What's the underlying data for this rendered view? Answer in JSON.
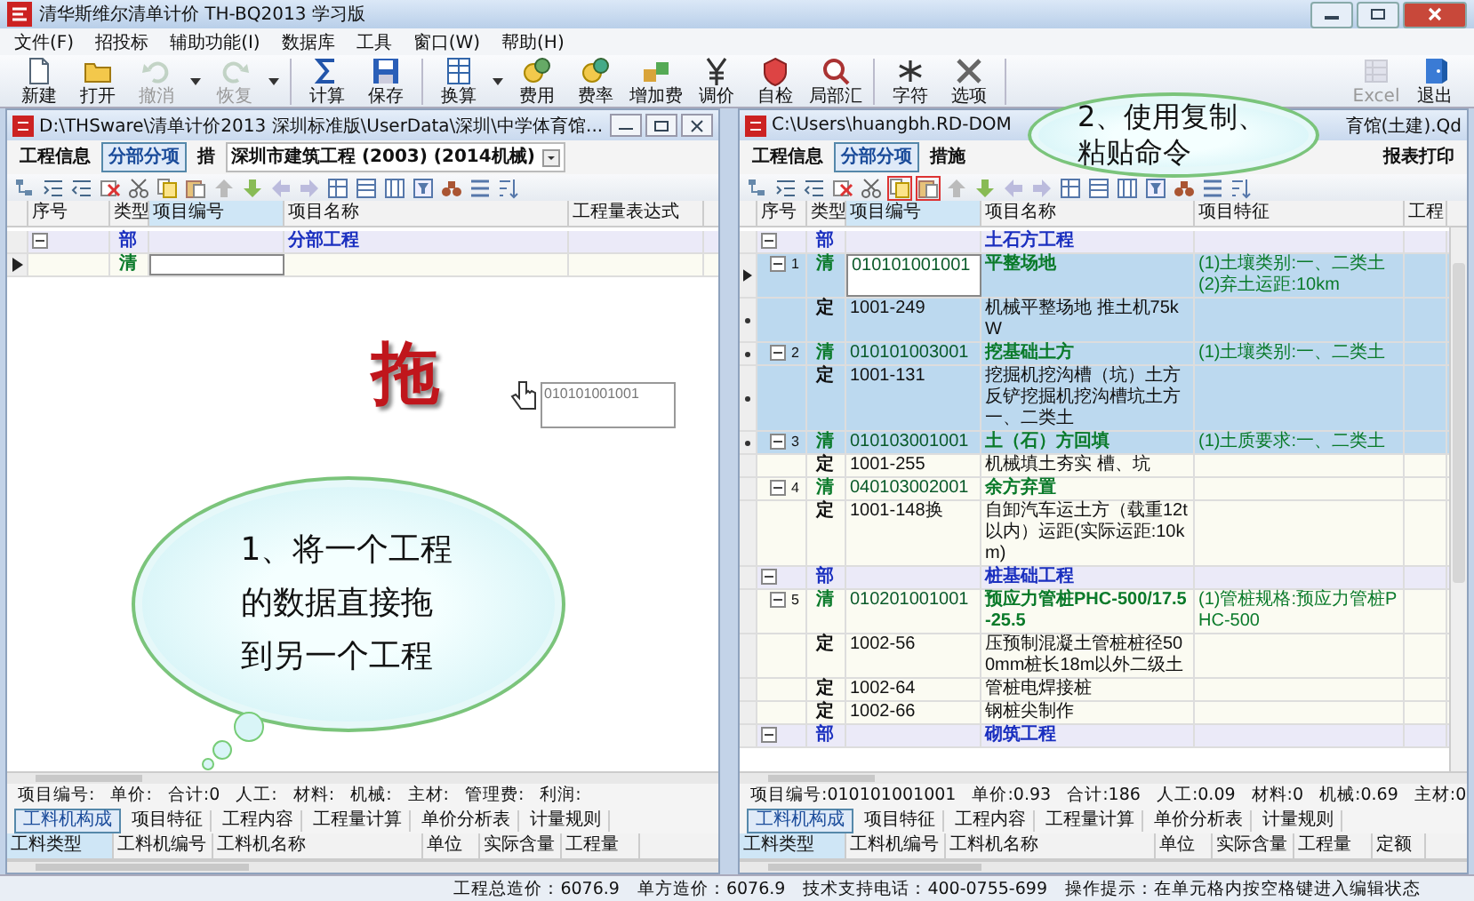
{
  "window": {
    "title": "清华斯维尔清单计价 TH-BQ2013 学习版"
  },
  "menu": [
    "文件(F)",
    "招投标",
    "辅助功能(I)",
    "数据库",
    "工具",
    "窗口(W)",
    "帮助(H)"
  ],
  "toolbar": [
    {
      "label": "新建",
      "kind": "new",
      "disabled": false,
      "dropdown": false
    },
    {
      "label": "打开",
      "kind": "open",
      "disabled": false,
      "dropdown": false
    },
    {
      "label": "撤消",
      "kind": "undo",
      "disabled": true,
      "dropdown": true
    },
    {
      "label": "恢复",
      "kind": "redo",
      "disabled": true,
      "dropdown": true
    },
    {
      "label": "计算",
      "kind": "calc",
      "disabled": false,
      "dropdown": false
    },
    {
      "label": "保存",
      "kind": "save",
      "disabled": false,
      "dropdown": false
    },
    {
      "label": "换算",
      "kind": "convert",
      "disabled": false,
      "dropdown": true
    },
    {
      "label": "费用",
      "kind": "fee",
      "disabled": false,
      "dropdown": false
    },
    {
      "label": "费率",
      "kind": "rate",
      "disabled": false,
      "dropdown": false
    },
    {
      "label": "增加费",
      "kind": "addfee",
      "disabled": false,
      "dropdown": false
    },
    {
      "label": "调价",
      "kind": "adjust",
      "disabled": false,
      "dropdown": false
    },
    {
      "label": "自检",
      "kind": "check",
      "disabled": false,
      "dropdown": false
    },
    {
      "label": "局部汇",
      "kind": "summary",
      "disabled": false,
      "dropdown": false
    },
    {
      "label": "字符",
      "kind": "char",
      "disabled": false,
      "dropdown": false
    },
    {
      "label": "选项",
      "kind": "options",
      "disabled": false,
      "dropdown": false
    },
    {
      "label": "Excel",
      "kind": "excel",
      "disabled": true,
      "dropdown": false
    },
    {
      "label": "退出",
      "kind": "exit",
      "disabled": false,
      "dropdown": false
    }
  ],
  "callouts": [
    {
      "text": "1、将一个工程的数据直接拖到另一个工程"
    },
    {
      "text": "2、使用复制、粘贴命令"
    }
  ],
  "drag_label": "拖",
  "drag_ghost": "010101001001",
  "panes": [
    {
      "title": "D:\\THSware\\清单计价2013 深圳标准版\\UserData\\深圳\\中学体育馆...",
      "tabs": [
        {
          "label": "工程信息",
          "selected": false
        },
        {
          "label": "分部分项",
          "selected": true
        },
        {
          "label": "措",
          "selected": false
        }
      ],
      "library": "深圳市建筑工程 (2003) (2014机械)",
      "columns": [
        "序号",
        "类型",
        "项目编号",
        "项目名称",
        "工程量表达式"
      ],
      "rows": [
        {
          "kind": "bu",
          "type": "部",
          "name": "分部工程",
          "selected": false,
          "expanded": true,
          "current": false
        },
        {
          "kind": "qing",
          "type": "清",
          "selected": false,
          "expanded": false,
          "current": true
        }
      ],
      "info": [
        "项目编号:",
        "单价:",
        "合计:0",
        "人工:",
        "材料:",
        "机械:",
        "主材:",
        "管理费:",
        "利润:"
      ],
      "bottom_tabs": [
        {
          "label": "工料机构成",
          "selected": true
        },
        {
          "label": "项目特征",
          "selected": false
        },
        {
          "label": "工程内容",
          "selected": false
        },
        {
          "label": "工程量计算",
          "selected": false
        },
        {
          "label": "单价分析表",
          "selected": false
        },
        {
          "label": "计量规则",
          "selected": false
        }
      ],
      "bottom_columns": [
        "工料类型",
        "工料机编号",
        "工料机名称",
        "单位",
        "实际含量",
        "工程量"
      ]
    },
    {
      "title": "C:\\Users\\huangbh.RD-DOM",
      "title_tail": "育馆(土建).Qd",
      "tabs": [
        {
          "label": "工程信息",
          "selected": false
        },
        {
          "label": "分部分项",
          "selected": true
        },
        {
          "label": "措施",
          "selected": false
        }
      ],
      "tabs_end": [
        {
          "label": "报表打印",
          "selected": false
        }
      ],
      "toolbar_highlight": true,
      "columns": [
        "序号",
        "类型",
        "项目编号",
        "项目名称",
        "项目特征",
        "工程"
      ],
      "rows": [
        {
          "kind": "bu",
          "type": "部",
          "name": "土石方工程",
          "selected": false,
          "expanded": true,
          "current": false
        },
        {
          "kind": "qing",
          "no": "1",
          "type": "清",
          "code": "010101001001",
          "name": "平整场地",
          "features": [
            "(1)土壤类别:一、二类土",
            "(2)弃土运距:10km"
          ],
          "selected": true,
          "expanded": true,
          "current": true
        },
        {
          "kind": "ding",
          "type": "定",
          "code": "1001-249",
          "name": "机械平整场地 推土机75kW",
          "selected": true,
          "expanded": false,
          "current": false
        },
        {
          "kind": "qing",
          "no": "2",
          "type": "清",
          "code": "010101003001",
          "name": "挖基础土方",
          "features": [
            "(1)土壤类别:一、二类土"
          ],
          "selected": true,
          "expanded": true,
          "current": false
        },
        {
          "kind": "ding",
          "type": "定",
          "code": "1001-131",
          "name": "挖掘机挖沟槽（坑）土方反铲挖掘机挖沟槽坑土方一、二类土",
          "selected": true,
          "expanded": false,
          "current": false
        },
        {
          "kind": "qing",
          "no": "3",
          "type": "清",
          "code": "010103001001",
          "name": "土（石）方回填",
          "features": [
            "(1)土质要求:一、二类土"
          ],
          "selected": true,
          "expanded": true,
          "current": false
        },
        {
          "kind": "ding",
          "type": "定",
          "code": "1001-255",
          "name": "机械填土夯实 槽、坑",
          "selected": false,
          "expanded": false,
          "current": false
        },
        {
          "kind": "qing",
          "no": "4",
          "type": "清",
          "code": "040103002001",
          "name": "余方弃置",
          "selected": false,
          "expanded": true,
          "current": false
        },
        {
          "kind": "ding",
          "type": "定",
          "code": "1001-148换",
          "name": "自卸汽车运土方（载重12t以内）运距(实际运距:10km)",
          "selected": false,
          "expanded": false,
          "current": false
        },
        {
          "kind": "bu",
          "type": "部",
          "name": "桩基础工程",
          "selected": false,
          "expanded": true,
          "current": false
        },
        {
          "kind": "qing",
          "no": "5",
          "type": "清",
          "code": "010201001001",
          "name": "预应力管桩PHC-500/17.5-25.5",
          "features": [
            "(1)管桩规格:预应力管桩PHC-500"
          ],
          "selected": false,
          "expanded": true,
          "current": false
        },
        {
          "kind": "ding",
          "type": "定",
          "code": "1002-56",
          "name": "压预制混凝土管桩桩径500mm桩长18m以外二级土",
          "selected": false,
          "expanded": false,
          "current": false
        },
        {
          "kind": "ding",
          "type": "定",
          "code": "1002-64",
          "name": "管桩电焊接桩",
          "selected": false,
          "expanded": false,
          "current": false
        },
        {
          "kind": "ding",
          "type": "定",
          "code": "1002-66",
          "name": "钢桩尖制作",
          "selected": false,
          "expanded": false,
          "current": false
        },
        {
          "kind": "bu",
          "type": "部",
          "name": "砌筑工程",
          "selected": false,
          "expanded": true,
          "current": false
        }
      ],
      "info": [
        "项目编号:010101001001",
        "单价:0.93",
        "合计:186",
        "人工:0.09",
        "材料:0",
        "机械:0.69",
        "主材:0"
      ],
      "bottom_tabs": [
        {
          "label": "工料机构成",
          "selected": true
        },
        {
          "label": "项目特征",
          "selected": false
        },
        {
          "label": "工程内容",
          "selected": false
        },
        {
          "label": "工程量计算",
          "selected": false
        },
        {
          "label": "单价分析表",
          "selected": false
        },
        {
          "label": "计量规则",
          "selected": false
        }
      ],
      "bottom_columns": [
        "工料类型",
        "工料机编号",
        "工料机名称",
        "单位",
        "实际含量",
        "工程量",
        "定额"
      ]
    }
  ],
  "status_bar": [
    "工程总造价：6076.9",
    "单方造价：6076.9",
    "技术支持电话：400-0755-699",
    "操作提示：在单元格内按空格键进入编辑状态"
  ]
}
